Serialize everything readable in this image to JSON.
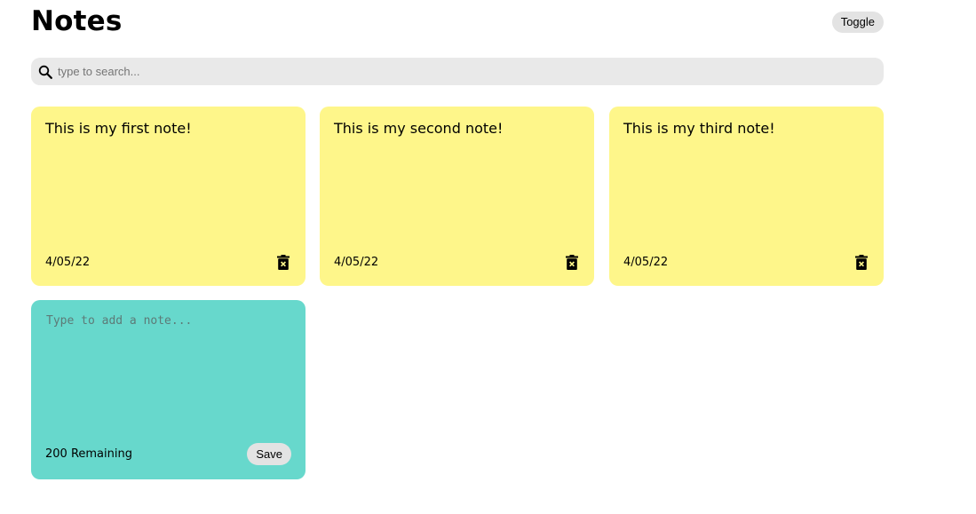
{
  "header": {
    "title": "Notes",
    "toggle_label": "Toggle"
  },
  "search": {
    "placeholder": "type to search...",
    "value": ""
  },
  "notes": [
    {
      "text": "This is my first note!",
      "date": "4/05/22"
    },
    {
      "text": "This is my second note!",
      "date": "4/05/22"
    },
    {
      "text": "This is my third note!",
      "date": "4/05/22"
    }
  ],
  "new_note": {
    "placeholder": "Type to add a note...",
    "remaining": "200 Remaining",
    "save_label": "Save"
  },
  "colors": {
    "note_bg": "#fef68a",
    "new_note_bg": "#67d8cc",
    "search_bg": "#e9e9e9",
    "button_bg": "#e3e3e3"
  },
  "icons": {
    "search": "search-icon",
    "delete": "trash-icon"
  }
}
